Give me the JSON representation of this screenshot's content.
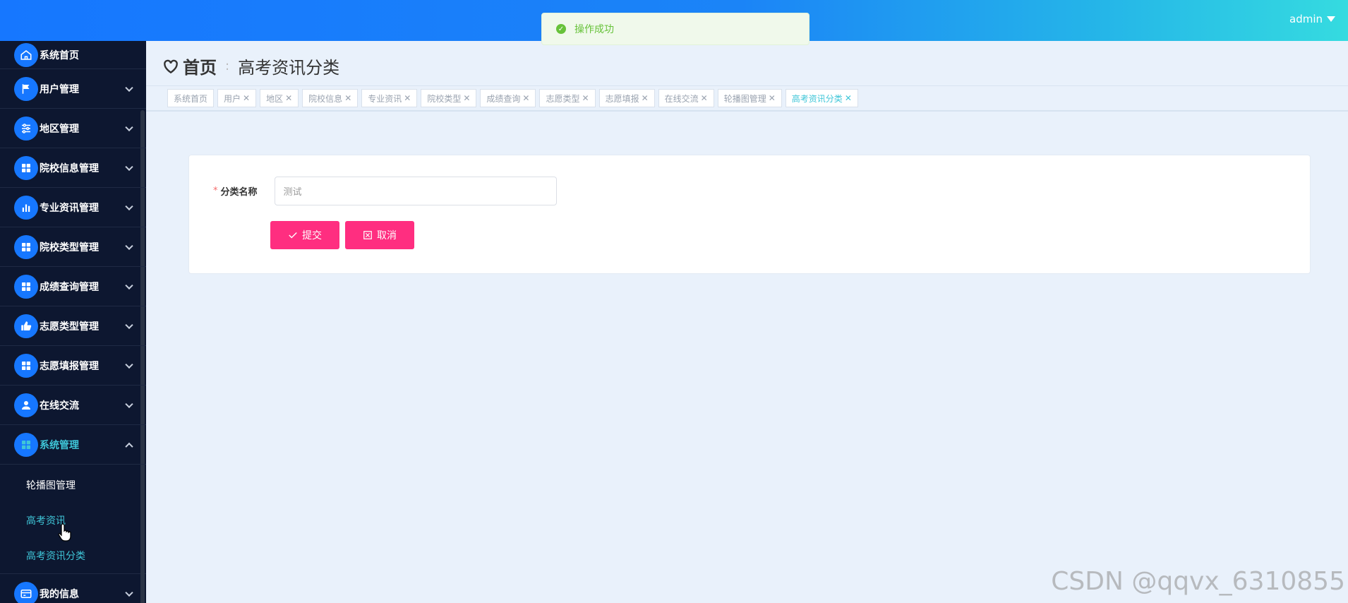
{
  "topbar": {
    "user": "admin"
  },
  "toast": {
    "message": "操作成功"
  },
  "sidebar": {
    "items": [
      {
        "label": "系统首页",
        "icon": "home-icon"
      },
      {
        "label": "用户管理",
        "icon": "flag-icon"
      },
      {
        "label": "地区管理",
        "icon": "sliders-icon"
      },
      {
        "label": "院校信息管理",
        "icon": "grid-icon"
      },
      {
        "label": "专业资讯管理",
        "icon": "bar-chart-icon"
      },
      {
        "label": "院校类型管理",
        "icon": "grid-icon"
      },
      {
        "label": "成绩查询管理",
        "icon": "grid-icon"
      },
      {
        "label": "志愿类型管理",
        "icon": "thumb-icon"
      },
      {
        "label": "志愿填报管理",
        "icon": "grid-icon"
      },
      {
        "label": "在线交流",
        "icon": "user-icon"
      },
      {
        "label": "系统管理",
        "icon": "grid-icon"
      },
      {
        "label": "我的信息",
        "icon": "card-icon"
      }
    ],
    "submenu": [
      "轮播图管理",
      "高考资讯",
      "高考资讯分类"
    ]
  },
  "breadcrumb": {
    "home": "首页",
    "separator": ":",
    "current": "高考资讯分类"
  },
  "tabs": [
    {
      "label": "系统首页",
      "closable": false
    },
    {
      "label": "用户",
      "closable": true
    },
    {
      "label": "地区",
      "closable": true
    },
    {
      "label": "院校信息",
      "closable": true
    },
    {
      "label": "专业资讯",
      "closable": true
    },
    {
      "label": "院校类型",
      "closable": true
    },
    {
      "label": "成绩查询",
      "closable": true
    },
    {
      "label": "志愿类型",
      "closable": true
    },
    {
      "label": "志愿填报",
      "closable": true
    },
    {
      "label": "在线交流",
      "closable": true
    },
    {
      "label": "轮播图管理",
      "closable": true
    },
    {
      "label": "高考资讯分类",
      "closable": true,
      "active": true
    }
  ],
  "form": {
    "required_mark": "*",
    "field_label": "分类名称",
    "field_value": "测试",
    "submit_label": "提交",
    "cancel_label": "取消"
  },
  "watermark": "CSDN @qqvx_6310855",
  "colors": {
    "accent": "#1677ff",
    "button": "#ff2e80",
    "highlight": "#3fc6d8",
    "sidebar_bg": "#0d1730"
  }
}
